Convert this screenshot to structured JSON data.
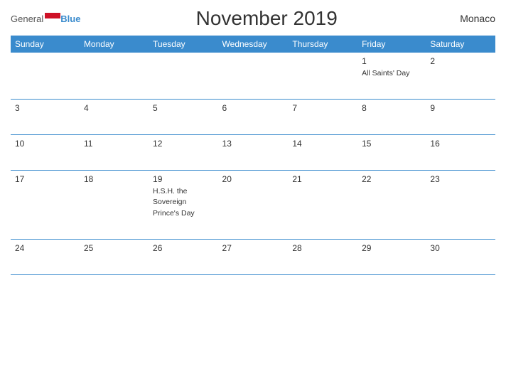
{
  "header": {
    "logo_general": "General",
    "logo_blue": "Blue",
    "title": "November 2019",
    "country": "Monaco"
  },
  "weekdays": [
    "Sunday",
    "Monday",
    "Tuesday",
    "Wednesday",
    "Thursday",
    "Friday",
    "Saturday"
  ],
  "weeks": [
    [
      {
        "day": "",
        "event": ""
      },
      {
        "day": "",
        "event": ""
      },
      {
        "day": "",
        "event": ""
      },
      {
        "day": "",
        "event": ""
      },
      {
        "day": "",
        "event": ""
      },
      {
        "day": "1",
        "event": "All Saints' Day"
      },
      {
        "day": "2",
        "event": ""
      }
    ],
    [
      {
        "day": "3",
        "event": ""
      },
      {
        "day": "4",
        "event": ""
      },
      {
        "day": "5",
        "event": ""
      },
      {
        "day": "6",
        "event": ""
      },
      {
        "day": "7",
        "event": ""
      },
      {
        "day": "8",
        "event": ""
      },
      {
        "day": "9",
        "event": ""
      }
    ],
    [
      {
        "day": "10",
        "event": ""
      },
      {
        "day": "11",
        "event": ""
      },
      {
        "day": "12",
        "event": ""
      },
      {
        "day": "13",
        "event": ""
      },
      {
        "day": "14",
        "event": ""
      },
      {
        "day": "15",
        "event": ""
      },
      {
        "day": "16",
        "event": ""
      }
    ],
    [
      {
        "day": "17",
        "event": ""
      },
      {
        "day": "18",
        "event": ""
      },
      {
        "day": "19",
        "event": "H.S.H. the Sovereign Prince's Day"
      },
      {
        "day": "20",
        "event": ""
      },
      {
        "day": "21",
        "event": ""
      },
      {
        "day": "22",
        "event": ""
      },
      {
        "day": "23",
        "event": ""
      }
    ],
    [
      {
        "day": "24",
        "event": ""
      },
      {
        "day": "25",
        "event": ""
      },
      {
        "day": "26",
        "event": ""
      },
      {
        "day": "27",
        "event": ""
      },
      {
        "day": "28",
        "event": ""
      },
      {
        "day": "29",
        "event": ""
      },
      {
        "day": "30",
        "event": ""
      }
    ]
  ]
}
